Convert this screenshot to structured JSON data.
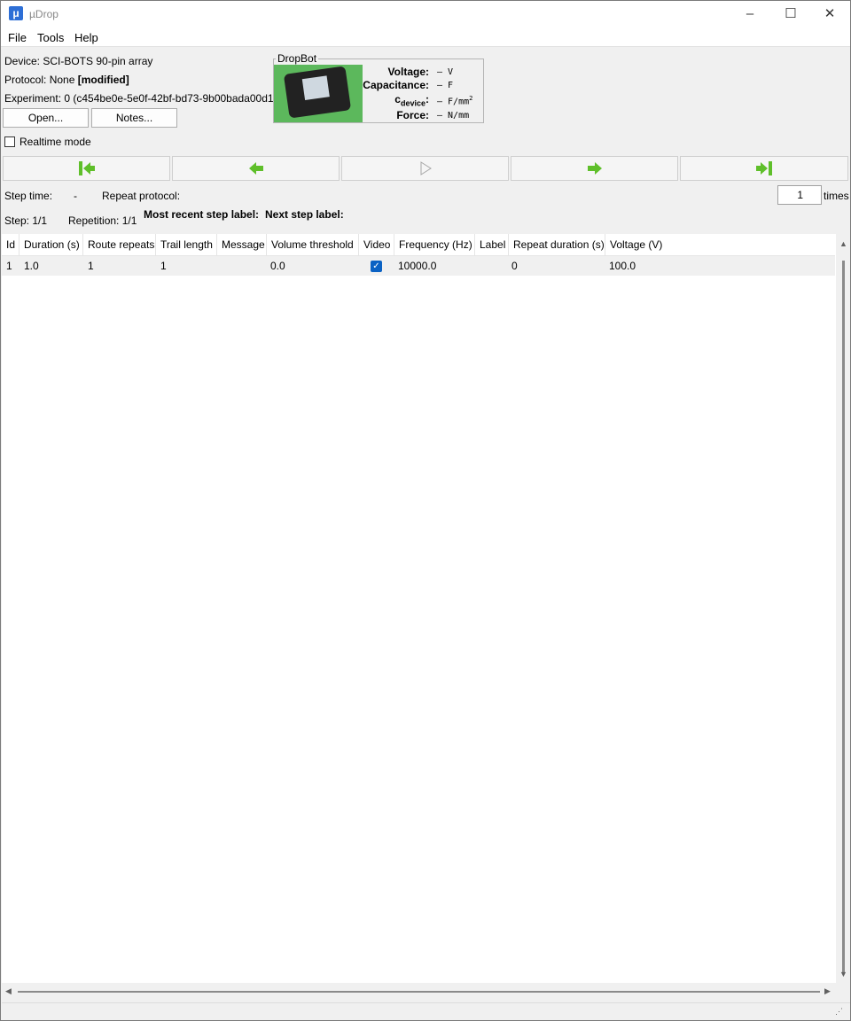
{
  "window": {
    "title": "µDrop",
    "icon_letter": "μ"
  },
  "menu": {
    "items": [
      "File",
      "Tools",
      "Help"
    ]
  },
  "info": {
    "device": "Device: SCI-BOTS 90-pin array",
    "protocol_prefix": "Protocol: None ",
    "protocol_modified": "[modified]",
    "experiment": "Experiment: 0 (c454be0e-5e0f-42bf-bd73-9b00bada00d1)"
  },
  "buttons": {
    "open": "Open...",
    "notes": "Notes..."
  },
  "dropbot": {
    "title": "DropBot",
    "voltage_label": "Voltage:",
    "voltage_value": "– V",
    "capacitance_label": "Capacitance:",
    "capacitance_value": "– F",
    "cdevice_label": "c",
    "cdevice_sub": "device",
    "cdevice_colon": ":",
    "cdevice_value": "– F/mm",
    "cdevice_sup": "2",
    "force_label": "Force:",
    "force_value": "– N/mm"
  },
  "realtime_mode": "Realtime mode",
  "steps": {
    "step_time_label": "Step time:",
    "step_time_value": "-",
    "repeat_protocol_label": "Repeat protocol:",
    "repeat_count": "1",
    "times": "times",
    "step": "Step: 1/1",
    "repetition": "Repetition: 1/1",
    "recent_label": "Most recent step label:",
    "next_label": "Next step label:"
  },
  "table": {
    "columns": [
      "Id",
      "Duration (s)",
      "Route repeats",
      "Trail length",
      "Message",
      "Volume threshold",
      "Video",
      "Frequency (Hz)",
      "Label",
      "Repeat duration (s)",
      "Voltage (V)"
    ],
    "rows": [
      {
        "id": "1",
        "duration": "1.0",
        "route_repeats": "1",
        "trail_length": "1",
        "message": "",
        "volume_threshold": "0.0",
        "video": true,
        "frequency": "10000.0",
        "label": "",
        "repeat_duration": "0",
        "voltage": "100.0"
      }
    ]
  },
  "colors": {
    "accent": "#2e6fd6",
    "nav_green": "#5fbf2a",
    "check_blue": "#0b62c4"
  }
}
